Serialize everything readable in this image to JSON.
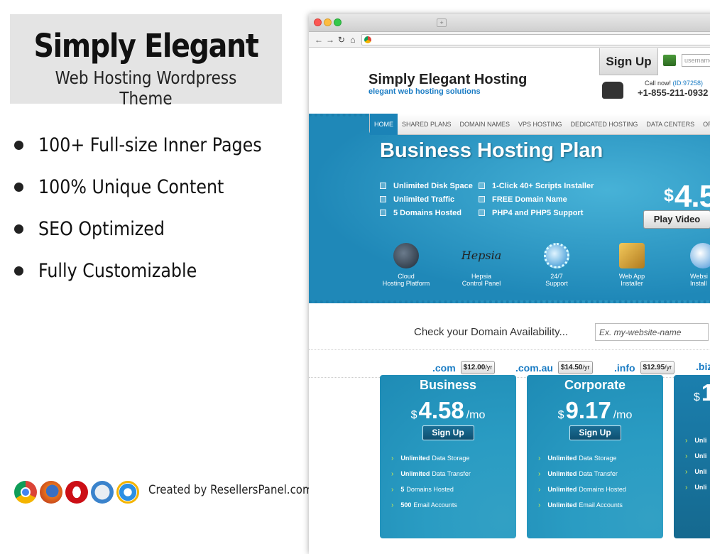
{
  "promo": {
    "title": "Simply Elegant",
    "subtitle": "Web Hosting Wordpress Theme",
    "features": [
      "100+ Full-size Inner Pages",
      "100% Unique Content",
      "SEO Optimized",
      "Fully Customizable"
    ],
    "browser_icons": [
      "chrome-icon",
      "firefox-icon",
      "opera-icon",
      "safari-icon",
      "ie-icon"
    ],
    "credit": "Created by ResellersPanel.com"
  },
  "site": {
    "signup": "Sign Up",
    "username_placeholder": "username",
    "logo_name": "Simply Elegant Hosting",
    "logo_tagline": "elegant web hosting solutions",
    "call_label": "Call now!",
    "call_id": "(ID:97258)",
    "phone": "+1-855-211-0932",
    "menu": [
      "HOME",
      "SHARED PLANS",
      "DOMAIN NAMES",
      "VPS HOSTING",
      "DEDICATED HOSTING",
      "DATA CENTERS",
      "ORDE"
    ],
    "hero": {
      "title": "Business Hosting Plan",
      "features_left": [
        "Unlimited Disk Space",
        "Unlimited Traffic",
        "5 Domains Hosted"
      ],
      "features_right": [
        "1-Click 40+ Scripts Installer",
        "FREE Domain Name",
        "PHP4 and PHP5 Support"
      ],
      "price_currency": "$",
      "price": "4.5",
      "play": "Play Video",
      "services": [
        {
          "l1": "Cloud",
          "l2": "Hosting Platform"
        },
        {
          "l1": "Hepsia",
          "l2": "Control Panel"
        },
        {
          "l1": "24/7",
          "l2": "Support"
        },
        {
          "l1": "Web App",
          "l2": "Installer"
        },
        {
          "l1": "Websi",
          "l2": "Install"
        }
      ],
      "hepsia_logo": "Hepsia"
    },
    "domain": {
      "label": "Check your Domain Availability...",
      "placeholder": "Ex. my-website-name",
      "tlds": [
        {
          "name": ".com",
          "price": "$12.00",
          "per": "/yr"
        },
        {
          "name": ".com.au",
          "price": "$14.50",
          "per": "/yr"
        },
        {
          "name": ".info",
          "price": "$12.95",
          "per": "/yr"
        },
        {
          "name": ".biz",
          "price": "",
          "per": ""
        }
      ]
    },
    "plans": [
      {
        "name": "Business",
        "currency": "$",
        "price": "4.58",
        "per": "/mo",
        "button": "Sign Up",
        "features": [
          [
            "Unlimited",
            "Data Storage"
          ],
          [
            "Unlimited",
            "Data Transfer"
          ],
          [
            "5",
            "Domains Hosted"
          ],
          [
            "500",
            "Email Accounts"
          ]
        ]
      },
      {
        "name": "Corporate",
        "currency": "$",
        "price": "9.17",
        "per": "/mo",
        "button": "Sign Up",
        "features": [
          [
            "Unlimited",
            "Data Storage"
          ],
          [
            "Unlimited",
            "Data Transfer"
          ],
          [
            "Unlimited",
            "Domains Hosted"
          ],
          [
            "Unlimited",
            "Email Accounts"
          ]
        ]
      },
      {
        "name": "",
        "currency": "$",
        "price": "1",
        "per": "",
        "button": "",
        "features": [
          [
            "Unli",
            ""
          ],
          [
            "Unli",
            ""
          ],
          [
            "Unli",
            ""
          ],
          [
            "Unli",
            ""
          ]
        ]
      }
    ]
  }
}
